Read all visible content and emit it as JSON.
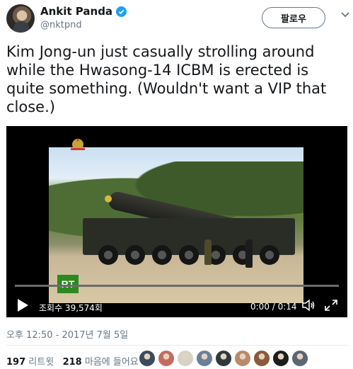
{
  "author": {
    "display_name": "Ankit Panda",
    "handle": "@nktpnd",
    "verified": true
  },
  "follow_button_label": "팔로우",
  "tweet_text": "Kim Jong-un just casually strolling around while the Hwasong-14 ICBM is erected is quite something. (Wouldn't want a VIP that close.)",
  "video": {
    "view_count": "조회수 39,574회",
    "time": "0:00 / 0:14",
    "progress": 0,
    "channel_logo": "RT"
  },
  "timestamp": "오후 12:50 - 2017년 7월 5일",
  "stats": {
    "retweets_count": "197",
    "retweets_label": "리트윗",
    "likes_count": "218",
    "likes_label": "마음에 들어요"
  },
  "liker_avatar_colors": [
    "#3b4a5c",
    "#c46b5e",
    "#d7d2c8",
    "#6a7f9a",
    "#2f3a3f",
    "#b88a6a",
    "#8a5a3c",
    "#1d1d1d",
    "#5a6670"
  ],
  "colors": {
    "accent": "#1da1f2",
    "text": "#14171a",
    "secondary_text": "#657786"
  }
}
